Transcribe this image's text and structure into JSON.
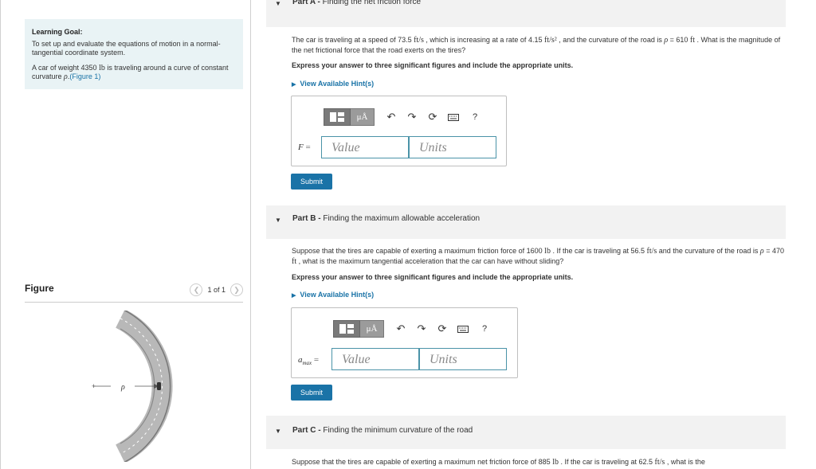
{
  "learning_goal": {
    "heading": "Learning Goal:",
    "text": "To set up and evaluate the equations of motion in a normal-tangential coordinate system.",
    "intro_prefix": "A car of weight 4350",
    "intro_unit": "lb",
    "intro_middle": "is traveling around a curve of constant curvature",
    "intro_var": "ρ",
    "intro_dot": ".",
    "figure_link": "(Figure 1)"
  },
  "figure": {
    "title": "Figure",
    "pager": "1 of 1",
    "label_rho": "ρ"
  },
  "part_a": {
    "prefix": "Part A -",
    "title": "Finding the net friction force",
    "problem": [
      {
        "t": "The car is traveling at a speed of 73.5 ",
        "c": ""
      },
      {
        "t": "ft/s",
        "c": "m"
      },
      {
        "t": " , which is increasing at a rate of 4.15 ",
        "c": ""
      },
      {
        "t": "ft/s²",
        "c": "m"
      },
      {
        "t": " , and the curvature of the road is ",
        "c": ""
      },
      {
        "t": "ρ",
        "c": "mi"
      },
      {
        "t": " = 610 ",
        "c": ""
      },
      {
        "t": "ft",
        "c": "m"
      },
      {
        "t": " . What is the magnitude of the net frictional force that the road exerts on the tires?",
        "c": ""
      }
    ],
    "instruction": "Express your answer to three significant figures and include the appropriate units.",
    "hint": "View Available Hint(s)",
    "answer_var": "F",
    "equals": "=",
    "value_placeholder": "Value",
    "units_placeholder": "Units",
    "submit": "Submit"
  },
  "part_b": {
    "prefix": "Part B -",
    "title": "Finding the maximum allowable acceleration",
    "problem": [
      {
        "t": "Suppose that the tires are capable of exerting a maximum friction force of 1600 ",
        "c": ""
      },
      {
        "t": "lb",
        "c": "m"
      },
      {
        "t": " . If the car is traveling at 56.5 ",
        "c": ""
      },
      {
        "t": "ft/s",
        "c": "m"
      },
      {
        "t": " and the curvature of the road is ",
        "c": ""
      },
      {
        "t": "ρ",
        "c": "mi"
      },
      {
        "t": " = 470 ",
        "c": ""
      },
      {
        "t": "ft",
        "c": "m"
      },
      {
        "t": " , what is the maximum tangential acceleration that the car can have without sliding?",
        "c": ""
      }
    ],
    "instruction": "Express your answer to three significant figures and include the appropriate units.",
    "hint": "View Available Hint(s)",
    "answer_var": "a",
    "answer_sub": "max",
    "equals": "=",
    "value_placeholder": "Value",
    "units_placeholder": "Units",
    "submit": "Submit"
  },
  "part_c": {
    "prefix": "Part C -",
    "title": "Finding the minimum curvature of the road",
    "problem": [
      {
        "t": "Suppose that the tires are capable of exerting a maximum net friction force of 885 ",
        "c": ""
      },
      {
        "t": "lb",
        "c": "m"
      },
      {
        "t": " . If the car is traveling at 62.5 ",
        "c": ""
      },
      {
        "t": "ft/s",
        "c": "m"
      },
      {
        "t": " , what is the",
        "c": ""
      }
    ]
  },
  "toolbar": {
    "units_symbol": "μÅ",
    "undo_icon": "↶",
    "redo_icon": "↷",
    "reset_icon": "⟳",
    "help": "?"
  }
}
